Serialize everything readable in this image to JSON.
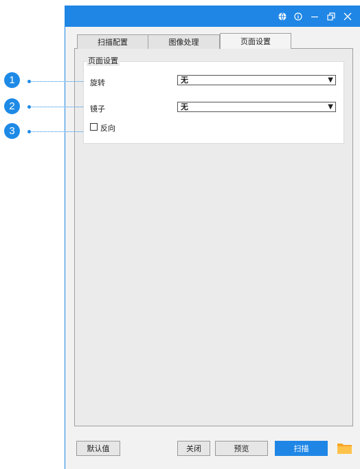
{
  "titlebar": {
    "icons": [
      "globe-icon",
      "info-icon",
      "minimize-icon",
      "restore-icon",
      "close-icon"
    ]
  },
  "tabs": [
    {
      "label": "扫描配置",
      "active": false
    },
    {
      "label": "图像处理",
      "active": false
    },
    {
      "label": "页面设置",
      "active": true
    }
  ],
  "group": {
    "title": "页面设置",
    "rotate": {
      "label": "旋转",
      "value": "无"
    },
    "mirror": {
      "label": "镜子",
      "value": "无"
    },
    "reverse": {
      "label": "反向",
      "checked": false
    }
  },
  "callouts": [
    "1",
    "2",
    "3"
  ],
  "footer": {
    "default_label": "默认值",
    "close_label": "关闭",
    "preview_label": "预览",
    "scan_label": "扫描"
  },
  "colors": {
    "accent": "#1f86e5",
    "folder": "#f5a623"
  }
}
